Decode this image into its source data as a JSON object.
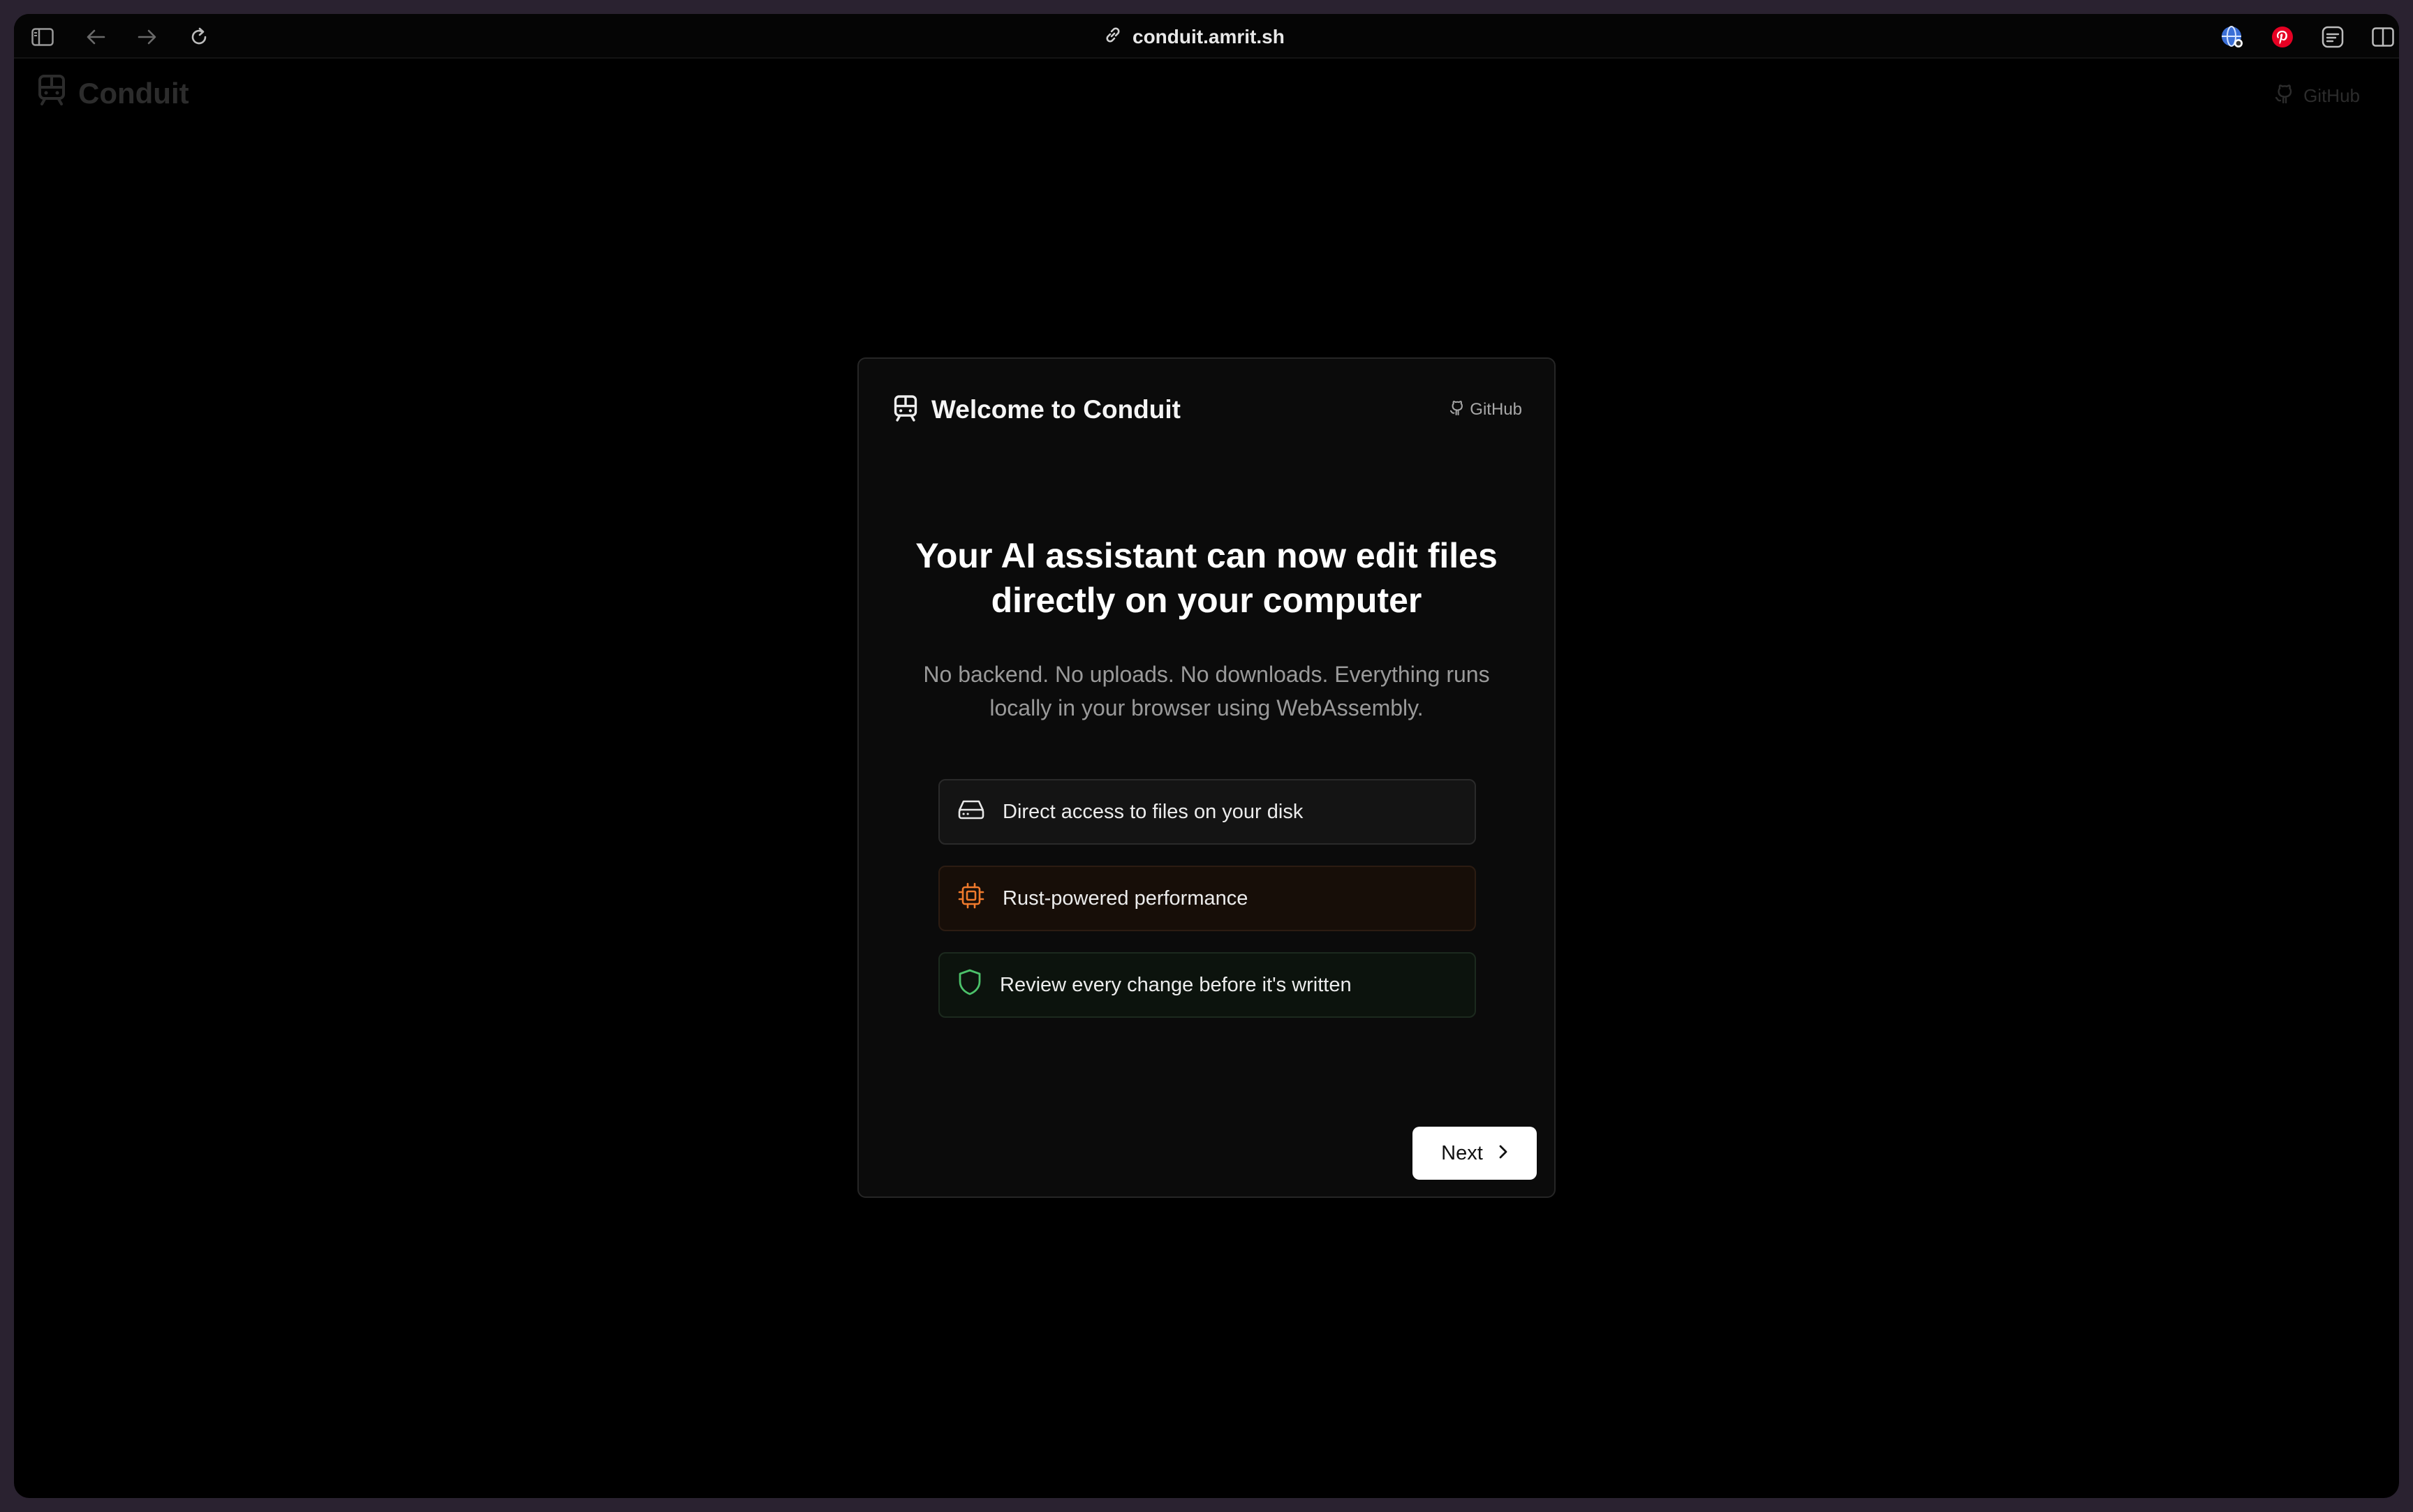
{
  "browser": {
    "url": "conduit.amrit.sh"
  },
  "app": {
    "name": "Conduit",
    "github_label": "GitHub"
  },
  "modal": {
    "title": "Welcome to Conduit",
    "github_label": "GitHub",
    "headline_line1": "Your AI assistant can now edit files",
    "headline_line2": "directly on your computer",
    "subtext_line1": "No backend. No uploads. No downloads. Everything runs",
    "subtext_line2": "locally in your browser using WebAssembly.",
    "features": [
      {
        "label": "Direct access to files on your disk",
        "icon": "hard-drive-icon",
        "color": "#e8e8e8"
      },
      {
        "label": "Rust-powered performance",
        "icon": "cpu-icon",
        "color": "#f07a2c"
      },
      {
        "label": "Review every change before it's written",
        "icon": "shield-icon",
        "color": "#4cc26a"
      }
    ],
    "next_label": "Next"
  }
}
